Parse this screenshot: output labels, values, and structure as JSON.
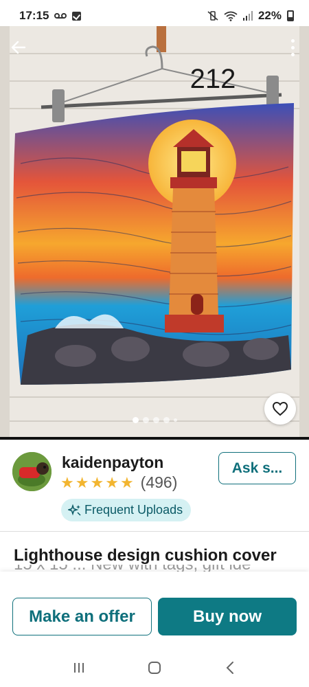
{
  "status_bar": {
    "time": "17:15",
    "voicemail_icon": "voicemail-icon",
    "notification_icon": "checkbox-notification-icon",
    "mute_icon": "vibrate-mute-icon",
    "wifi_icon": "wifi-icon",
    "signal_icon": "signal-icon",
    "battery": "22%"
  },
  "hero": {
    "image_label": "212",
    "back_icon": "back-arrow-icon",
    "more_icon": "more-vertical-icon",
    "like_icon": "heart-icon",
    "carousel": {
      "total_dots": 5,
      "active_index": 0
    }
  },
  "seller": {
    "name": "kaidenpayton",
    "stars": 5,
    "rating_count": "(496)",
    "badge_label": "Frequent Uploads",
    "badge_icon": "sparkle-icon",
    "ask_label": "Ask s..."
  },
  "listing": {
    "title": "Lighthouse design cushion cover",
    "title_cut_line": "15 x 15 ... New with tags, gift ide"
  },
  "actions": {
    "offer_label": "Make an offer",
    "buy_label": "Buy now"
  },
  "colors": {
    "accent": "#0e7a84",
    "star": "#f2b530",
    "badge_bg": "#d5f1f3"
  },
  "navbar": {
    "recents_icon": "recent-apps-icon",
    "home_icon": "home-icon",
    "back_icon": "back-chevron-icon"
  }
}
